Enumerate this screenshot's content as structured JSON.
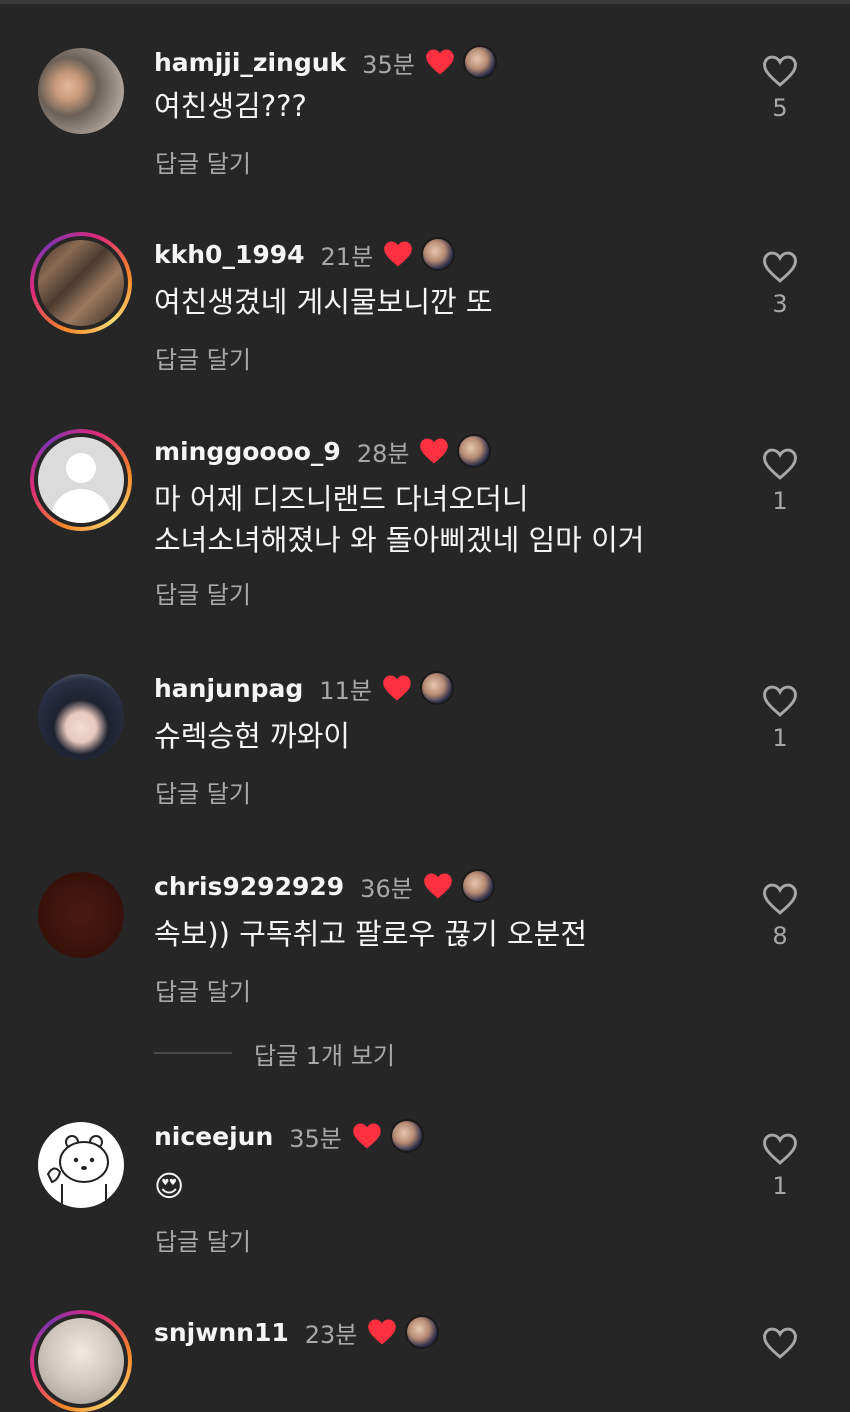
{
  "comments": [
    {
      "username": "hamjji_zinguk",
      "time": "35분",
      "text": [
        "여친생김???"
      ],
      "reply": "답글 달기",
      "likes": "5",
      "avatar_color": "#7b6a5c",
      "ring": false,
      "avatar_icon": "photo-avatar-icon"
    },
    {
      "username": "kkh0_1994",
      "time": "21분",
      "text": [
        "여친생겼네 게시물보니깐 또"
      ],
      "reply": "답글 달기",
      "likes": "3",
      "avatar_color": "#5c4a3c",
      "ring": true,
      "avatar_icon": "photo-avatar-icon"
    },
    {
      "username": "minggoooo_9",
      "time": "28분",
      "text": [
        "마 어제 디즈니랜드 다녀오더니",
        "소녀소녀해졌나 와 돌아삐겠네 임마 이거"
      ],
      "reply": "답글 달기",
      "likes": "1",
      "avatar_color": "#d8d8d8",
      "ring": true,
      "avatar_icon": "default-avatar-icon"
    },
    {
      "username": "hanjunpag",
      "time": "11분",
      "text": [
        "슈렉승현 까와이"
      ],
      "reply": "답글 달기",
      "likes": "1",
      "avatar_color": "#6f7a88",
      "ring": false,
      "avatar_icon": "anime-avatar-icon"
    },
    {
      "username": "chris9292929",
      "time": "36분",
      "text": [
        "속보)) 구독취고 팔로우 끊기 오분전"
      ],
      "reply": "답글 달기",
      "likes": "8",
      "avatar_color": "#3b130b",
      "ring": false,
      "avatar_icon": "dark-avatar-icon"
    },
    {
      "username": "niceejun",
      "time": "35분",
      "text": [
        "😍"
      ],
      "reply": "답글 달기",
      "likes": "1",
      "avatar_color": "#ffffff",
      "ring": false,
      "avatar_icon": "bear-avatar-icon"
    },
    {
      "username": "snjwnn11",
      "time": "23분",
      "text": [],
      "reply": "",
      "likes": "",
      "avatar_color": "#cfc7bd",
      "ring": true,
      "avatar_icon": "photo-avatar-icon"
    }
  ],
  "view_replies": "답글 1개 보기",
  "colors": {
    "background": "#262626",
    "heart_red": "#ff3040",
    "muted": "#a8a8a8"
  }
}
